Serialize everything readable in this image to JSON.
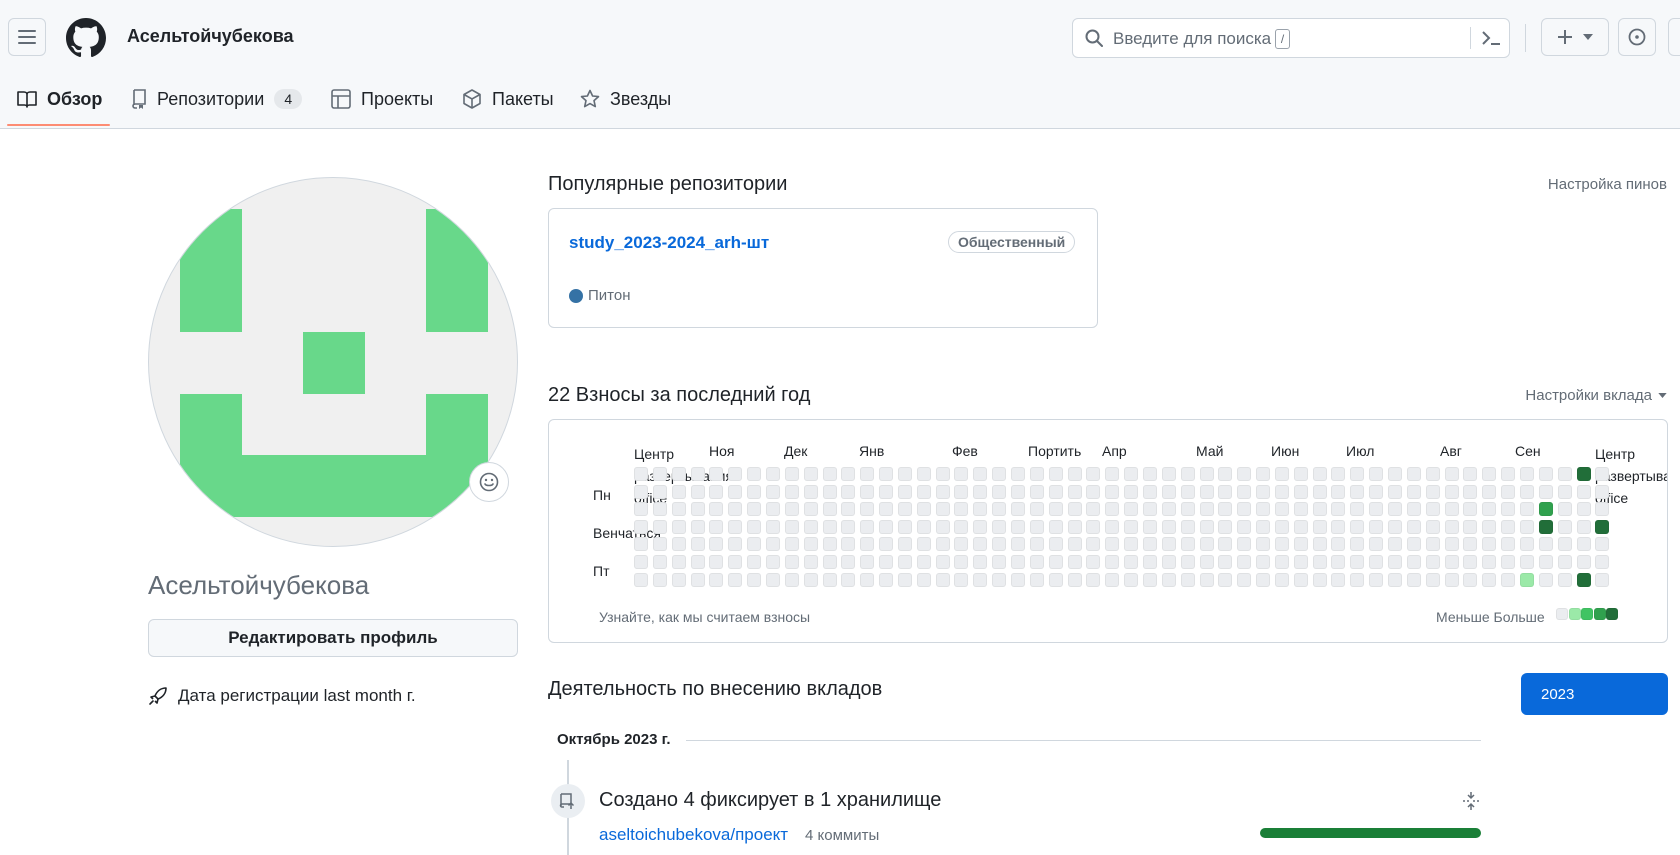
{
  "header": {
    "username": "Асельтойчубекова",
    "search_placeholder": "Введите для поиска",
    "search_shortcut": "/"
  },
  "tabs": [
    {
      "label": "Обзор",
      "icon": "book-icon"
    },
    {
      "label": "Репозитории",
      "icon": "repo-icon",
      "count": "4"
    },
    {
      "label": "Проекты",
      "icon": "table-icon"
    },
    {
      "label": "Пакеты",
      "icon": "package-icon"
    },
    {
      "label": "Звезды",
      "icon": "star-icon"
    }
  ],
  "profile": {
    "name": "Асельтойчубекова",
    "edit_label": "Редактировать профиль",
    "joined": "Дата регистрации last month г.",
    "avatar_color": "#68d88a"
  },
  "pinned": {
    "heading": "Популярные репозитории",
    "customize": "Настройка пинов",
    "repo": {
      "name": "study_2023-2024_arh-шт",
      "visibility": "Общественный",
      "language": "Питон",
      "language_color": "#3572A5"
    }
  },
  "contributions": {
    "heading": "22 Взносы за последний год",
    "settings": "Настройки вклада",
    "months": [
      "Центр развертывания office",
      "Ноя",
      "Дек",
      "Янв",
      "Фев",
      "Портить",
      "Апр",
      "Май",
      "Июн",
      "Июл",
      "Авг",
      "Сен",
      "Центр развертывания office"
    ],
    "days": [
      "Пн",
      "Венчаться",
      "Пт"
    ],
    "learn_link": "Узнайте, как мы считаем взносы",
    "legend_less_more": "Меньше Больше",
    "legend_colors": [
      "#ebedf0",
      "#9be9a8",
      "#40c463",
      "#30a14e",
      "#216e39"
    ],
    "active_cells": [
      {
        "week": 50,
        "day": 0,
        "level": 4
      },
      {
        "week": 48,
        "day": 2,
        "level": 3
      },
      {
        "week": 48,
        "day": 3,
        "level": 4
      },
      {
        "week": 51,
        "day": 3,
        "level": 4
      },
      {
        "week": 47,
        "day": 6,
        "level": 1
      },
      {
        "week": 50,
        "day": 6,
        "level": 4
      }
    ]
  },
  "activity": {
    "heading": "Деятельность по внесению вкладов",
    "year": "2023",
    "month_label": "Октябрь 2023 г.",
    "title": "Создано 4 фиксирует в 1 хранилище",
    "repo": "aseltoichubekova/проект",
    "commits": "4 коммиты"
  }
}
